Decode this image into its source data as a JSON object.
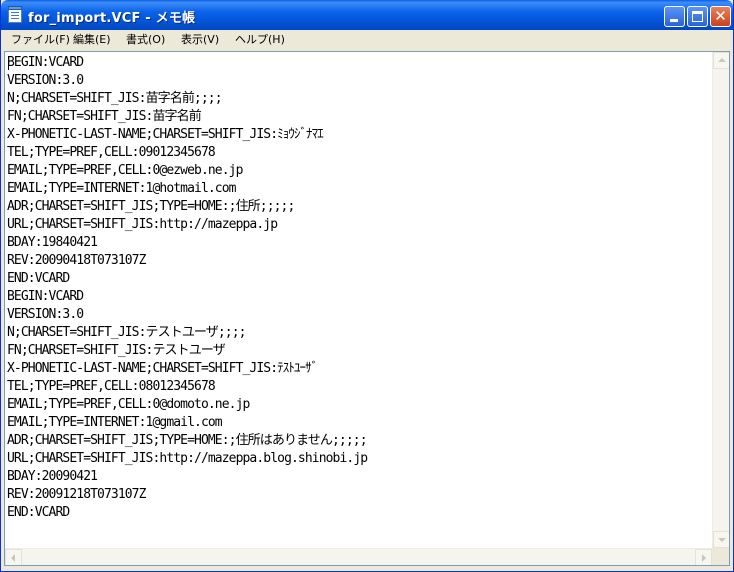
{
  "window": {
    "title": "for_import.VCF - メモ帳"
  },
  "menu": {
    "items": [
      {
        "label": "ファイル(F)"
      },
      {
        "label": "編集(E)"
      },
      {
        "label": "書式(O)"
      },
      {
        "label": "表示(V)"
      },
      {
        "label": "ヘルプ(H)"
      }
    ]
  },
  "document": {
    "lines": [
      "BEGIN:VCARD",
      "VERSION:3.0",
      "N;CHARSET=SHIFT_JIS:苗字名前;;;;",
      "FN;CHARSET=SHIFT_JIS:苗字名前",
      "X-PHONETIC-LAST-NAME;CHARSET=SHIFT_JIS:ﾐｮｳｼﾞﾅﾏｴ",
      "TEL;TYPE=PREF,CELL:09012345678",
      "EMAIL;TYPE=PREF,CELL:0@ezweb.ne.jp",
      "EMAIL;TYPE=INTERNET:1@hotmail.com",
      "ADR;CHARSET=SHIFT_JIS;TYPE=HOME:;住所;;;;;",
      "URL;CHARSET=SHIFT_JIS:http://mazeppa.jp",
      "BDAY:19840421",
      "REV:20090418T073107Z",
      "END:VCARD",
      "BEGIN:VCARD",
      "VERSION:3.0",
      "N;CHARSET=SHIFT_JIS:テストユーザ;;;;",
      "FN;CHARSET=SHIFT_JIS:テストユーザ",
      "X-PHONETIC-LAST-NAME;CHARSET=SHIFT_JIS:ﾃｽﾄﾕｰｻﾞ",
      "TEL;TYPE=PREF,CELL:08012345678",
      "EMAIL;TYPE=PREF,CELL:0@domoto.ne.jp",
      "EMAIL;TYPE=INTERNET:1@gmail.com",
      "ADR;CHARSET=SHIFT_JIS;TYPE=HOME:;住所はありません;;;;;",
      "URL;CHARSET=SHIFT_JIS:http://mazeppa.blog.shinobi.jp",
      "BDAY:20090421",
      "REV:20091218T073107Z",
      "END:VCARD"
    ]
  },
  "colors": {
    "titlebar": "#0A5EE0",
    "close_button": "#C9421F",
    "menu_background": "#ECE9D8",
    "editor_background": "#FFFFFF"
  }
}
